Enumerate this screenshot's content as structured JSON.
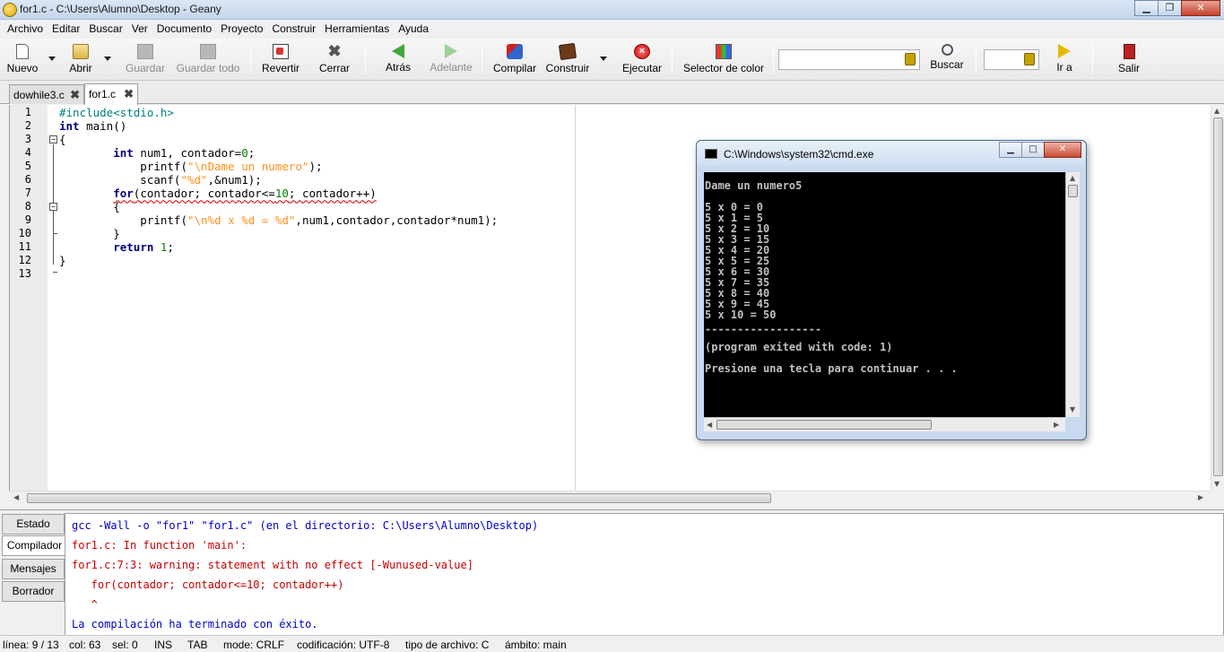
{
  "window": {
    "title": "for1.c - C:\\Users\\Alumno\\Desktop - Geany",
    "minimize": "▁",
    "maximize": "❐",
    "close": "✕"
  },
  "menu": [
    "Archivo",
    "Editar",
    "Buscar",
    "Ver",
    "Documento",
    "Proyecto",
    "Construir",
    "Herramientas",
    "Ayuda"
  ],
  "toolbar": {
    "new": "Nuevo",
    "open": "Abrir",
    "save": "Guardar",
    "save_all": "Guardar todo",
    "revert": "Revertir",
    "close": "Cerrar",
    "back": "Atrás",
    "forward": "Adelante",
    "compile": "Compilar",
    "build": "Construir",
    "execute": "Ejecutar",
    "color_picker": "Selector de color",
    "search": "Buscar",
    "goto": "Ir a",
    "quit": "Salir",
    "search_value": "",
    "goto_value": ""
  },
  "tabs": [
    {
      "label": "dowhile3.c",
      "close": "✖"
    },
    {
      "label": "for1.c",
      "close": "✖"
    }
  ],
  "editor": {
    "line_numbers": [
      "1",
      "2",
      "3",
      "4",
      "5",
      "6",
      "7",
      "8",
      "9",
      "10",
      "11",
      "12",
      "13"
    ],
    "fold_marker": "−",
    "code": {
      "l1": "#include<stdio.h>",
      "l2_kw": "int",
      "l2_rest": " main()",
      "l3": "{",
      "l4_indent": "        ",
      "l4_kw": "int",
      "l4_a": " num1, contador=",
      "l4_num": "0",
      "l4_b": ";",
      "l5_a": "            printf(",
      "l5_str": "\"\\nDame un numero\"",
      "l5_b": ");",
      "l6_a": "            scanf(",
      "l6_str": "\"%d\"",
      "l6_b": ",&num1);",
      "l7_indent": "        ",
      "l7_kw": "for",
      "l7_a": "(contador; contador<=",
      "l7_num": "10",
      "l7_b": "; contador++)",
      "l8": "        {",
      "l9_a": "            printf(",
      "l9_str": "\"\\n%d x %d = %d\"",
      "l9_b": ",num1,contador,contador*num1);",
      "l10": "        }",
      "l11_indent": "        ",
      "l11_kw": "return",
      "l11_a": " ",
      "l11_num": "1",
      "l11_b": ";",
      "l12": "}"
    }
  },
  "bottom_tabs": [
    "Estado",
    "Compilador",
    "Mensajes",
    "Borrador"
  ],
  "compiler_messages": [
    "gcc -Wall -o \"for1\" \"for1.c\" (en el directorio: C:\\Users\\Alumno\\Desktop)",
    "for1.c: In function 'main':",
    "for1.c:7:3: warning: statement with no effect [-Wunused-value]",
    "   for(contador; contador<=10; contador++)",
    "   ^",
    "La compilación ha terminado con éxito."
  ],
  "statusbar": {
    "line": "línea: 9 / 13",
    "col": "col: 63",
    "sel": "sel: 0",
    "ins": "INS",
    "tab": "TAB",
    "mode": "mode: CRLF",
    "encoding": "codificación: UTF-8",
    "filetype": "tipo de archivo: C",
    "scope": "ámbito: main"
  },
  "cmd": {
    "title": "C:\\Windows\\system32\\cmd.exe",
    "minimize": "▁",
    "maximize": "□",
    "close": "✕",
    "lines": [
      "Dame un numero5",
      "",
      "5 x 0 = 0",
      "5 x 1 = 5",
      "5 x 2 = 10",
      "5 x 3 = 15",
      "5 x 4 = 20",
      "5 x 5 = 25",
      "5 x 6 = 30",
      "5 x 7 = 35",
      "5 x 8 = 40",
      "5 x 9 = 45",
      "5 x 10 = 50",
      "------------------",
      "(program exited with code: 1)",
      "",
      "Presione una tecla para continuar . . ."
    ]
  },
  "colors": {
    "keyword": "#00007f",
    "string": "#ff901e",
    "number": "#007f00",
    "preprocessor": "#007f7f",
    "error": "#c80000",
    "info": "#0000c8"
  }
}
